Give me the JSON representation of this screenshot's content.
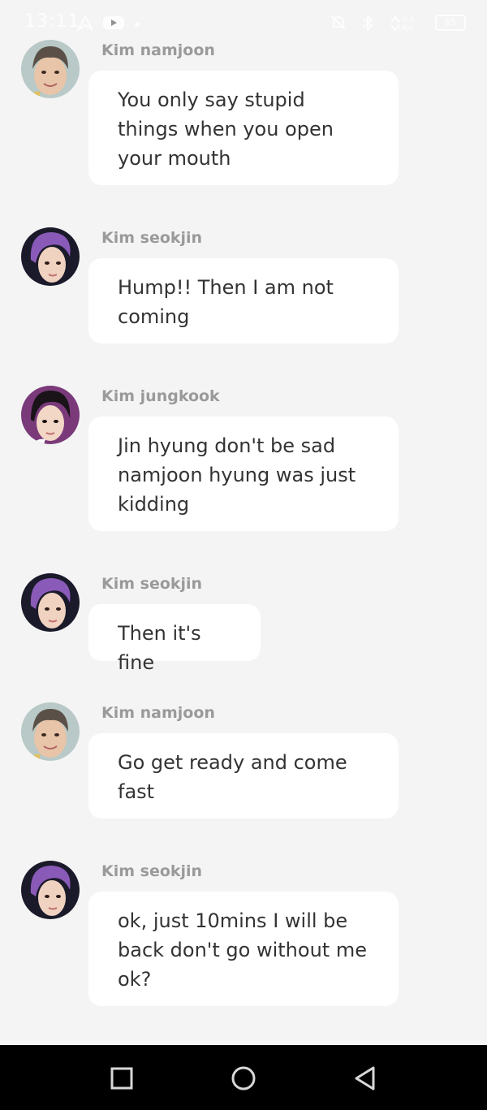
{
  "status_bar": {
    "time": "13:11",
    "icons": [
      "navigation-icon",
      "youtube-icon",
      "dot-icon",
      "alarm-icon",
      "bluetooth-icon",
      "network-speed-icon",
      "battery-icon"
    ],
    "battery": "85"
  },
  "messages": [
    {
      "sender": "Kim namjoon",
      "text": "You only say stupid things when you open your mouth",
      "avatar": "namjoon-avatar"
    },
    {
      "sender": "Kim seokjin",
      "text": "Hump!! Then I am not coming",
      "avatar": "seokjin-avatar"
    },
    {
      "sender": "Kim jungkook",
      "text": "Jin hyung don't be sad namjoon hyung was just kidding",
      "avatar": "jungkook-avatar"
    },
    {
      "sender": "Kim seokjin",
      "text": "Then it's fine",
      "avatar": "seokjin-avatar"
    },
    {
      "sender": "Kim namjoon",
      "text": "Go get ready and come fast",
      "avatar": "namjoon-avatar"
    },
    {
      "sender": "Kim seokjin",
      "text": "ok, just 10mins I will be back don't go without me ok?",
      "avatar": "seokjin-avatar"
    }
  ],
  "nav_bar": {
    "buttons": [
      "recent-apps-icon",
      "home-icon",
      "back-icon"
    ]
  },
  "colors": {
    "background": "#f4f4f4",
    "bubble": "#ffffff",
    "sender": "#9a9a9a",
    "text": "#333333",
    "nav": "#000000"
  }
}
